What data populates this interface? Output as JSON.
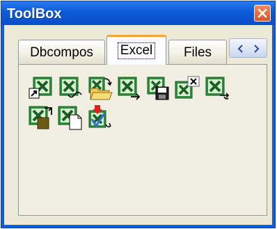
{
  "window": {
    "title": "ToolBox"
  },
  "tabs": [
    {
      "label": "Dbcompos",
      "active": false
    },
    {
      "label": "Excel",
      "active": true
    },
    {
      "label": "Files",
      "active": false
    }
  ],
  "components": [
    {
      "icon": "excel-shortcut-icon"
    },
    {
      "icon": "excel-link-icon"
    },
    {
      "icon": "excel-open-icon"
    },
    {
      "icon": "excel-export-icon"
    },
    {
      "icon": "excel-save-icon"
    },
    {
      "icon": "excel-close-icon"
    },
    {
      "icon": "excel-print-icon"
    },
    {
      "icon": "excel-import-icon"
    },
    {
      "icon": "excel-new-icon"
    },
    {
      "icon": "excel-check-icon"
    }
  ],
  "colors": {
    "title_bar": "#0a5fe0",
    "client": "#ece9d8",
    "excel_green": "#2e8b3a",
    "active_tab_accent": "#f2a530"
  }
}
